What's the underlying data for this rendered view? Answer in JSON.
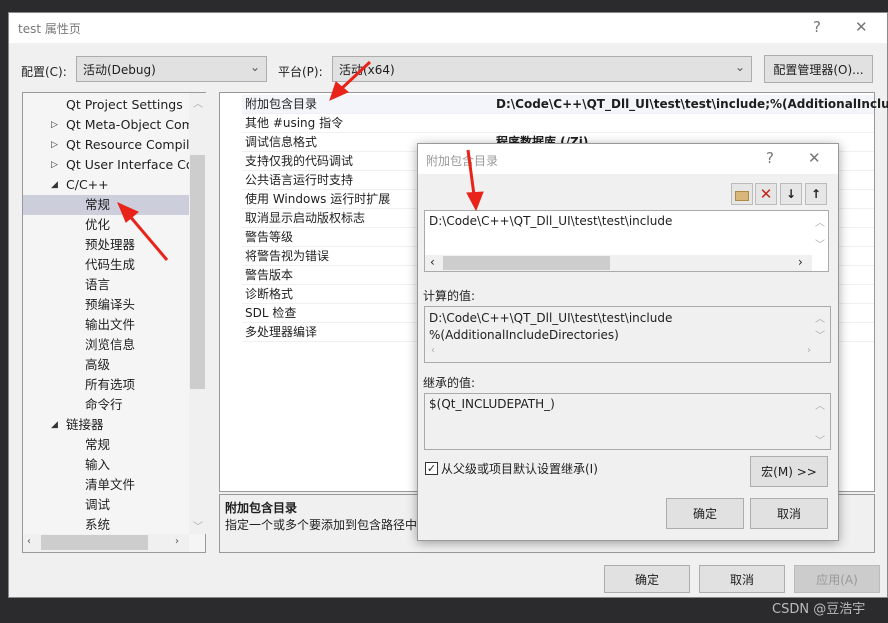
{
  "window": {
    "title": "test 属性页",
    "help": "?",
    "close": "✕"
  },
  "config": {
    "label": "配置(C):",
    "value": "活动(Debug)",
    "platform_label": "平台(P):",
    "platform_value": "活动(x64)",
    "manager_button": "配置管理器(O)..."
  },
  "tree": {
    "items": [
      {
        "label": "Qt Project Settings",
        "level": 1,
        "expander": ""
      },
      {
        "label": "Qt Meta-Object Com",
        "level": 1,
        "expander": "▷"
      },
      {
        "label": "Qt Resource Compile",
        "level": 1,
        "expander": "▷"
      },
      {
        "label": "Qt User Interface Cor",
        "level": 1,
        "expander": "▷"
      },
      {
        "label": "C/C++",
        "level": 1,
        "expander": "◢"
      },
      {
        "label": "常规",
        "level": 2,
        "selected": true
      },
      {
        "label": "优化",
        "level": 2
      },
      {
        "label": "预处理器",
        "level": 2
      },
      {
        "label": "代码生成",
        "level": 2
      },
      {
        "label": "语言",
        "level": 2
      },
      {
        "label": "预编译头",
        "level": 2
      },
      {
        "label": "输出文件",
        "level": 2
      },
      {
        "label": "浏览信息",
        "level": 2
      },
      {
        "label": "高级",
        "level": 2
      },
      {
        "label": "所有选项",
        "level": 2
      },
      {
        "label": "命令行",
        "level": 2
      },
      {
        "label": "链接器",
        "level": 1,
        "expander": "◢"
      },
      {
        "label": "常规",
        "level": 2
      },
      {
        "label": "输入",
        "level": 2
      },
      {
        "label": "清单文件",
        "level": 2
      },
      {
        "label": "调试",
        "level": 2
      },
      {
        "label": "系统",
        "level": 2
      }
    ]
  },
  "grid": {
    "rows": [
      {
        "name": "附加包含目录",
        "value": "D:\\Code\\C++\\QT_Dll_UI\\test\\test\\include;%(AdditionalInclud"
      },
      {
        "name": "其他 #using 指令",
        "value": ""
      },
      {
        "name": "调试信息格式",
        "value": "程序数据库 (/Zi)"
      },
      {
        "name": "支持仅我的代码调试",
        "value": ""
      },
      {
        "name": "公共语言运行时支持",
        "value": ""
      },
      {
        "name": "使用 Windows 运行时扩展",
        "value": ""
      },
      {
        "name": "取消显示启动版权标志",
        "value": ""
      },
      {
        "name": "警告等级",
        "value": ""
      },
      {
        "name": "将警告视为错误",
        "value": ""
      },
      {
        "name": "警告版本",
        "value": ""
      },
      {
        "name": "诊断格式",
        "value": ""
      },
      {
        "name": "SDL 检查",
        "value": ""
      },
      {
        "name": "多处理器编译",
        "value": ""
      }
    ]
  },
  "description": {
    "title": "附加包含目录",
    "text": "指定一个或多个要添加到包含路径中的"
  },
  "buttons": {
    "ok": "确定",
    "cancel": "取消",
    "apply": "应用(A)"
  },
  "child": {
    "title": "附加包含目录",
    "help": "?",
    "close": "✕",
    "toolbar": [
      "new-folder-icon",
      "delete-icon",
      "move-down-icon",
      "move-up-icon"
    ],
    "entries": [
      "D:\\Code\\C++\\QT_Dll_UI\\test\\test\\include"
    ],
    "computed_label": "计算的值:",
    "computed": [
      "D:\\Code\\C++\\QT_Dll_UI\\test\\test\\include",
      "%(AdditionalIncludeDirectories)"
    ],
    "inherited_label": "继承的值:",
    "inherited": "$(Qt_INCLUDEPATH_)",
    "inherit_checkbox": "从父级或项目默认设置继承(I)",
    "inherit_checked": true,
    "macro_button": "宏(M) >>",
    "ok": "确定",
    "cancel": "取消"
  },
  "watermark": "CSDN @豆浩宇",
  "colors": {
    "selection": "#cccedb",
    "arrow": "#e8231a"
  }
}
